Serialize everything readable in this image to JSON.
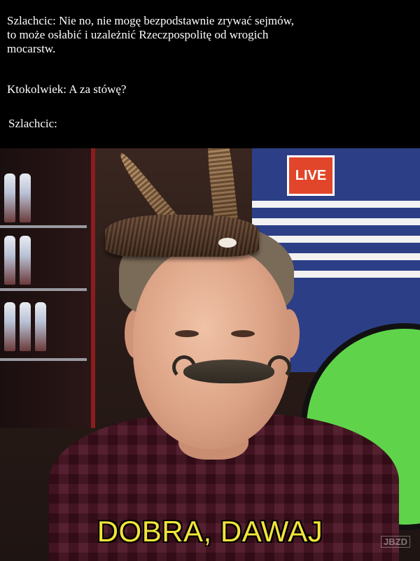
{
  "caption": {
    "line1": "Szlachcic: Nie no, nie mogę bezpodstawnie zrywać sejmów,\nto może osłabić i uzależnić Rzeczpospolitę od wrogich\nmocarstw.",
    "line2": "Ktokolwiek: A za stówę?",
    "line3": "Szlachcic:"
  },
  "photo": {
    "screen_badge": "LIVE",
    "subtitle": "DOBRA, DAWAJ",
    "watermark": "JBZD"
  },
  "colors": {
    "subtitle": "#f3e33a",
    "caption_bg": "#000000",
    "caption_text": "#ffffff"
  }
}
